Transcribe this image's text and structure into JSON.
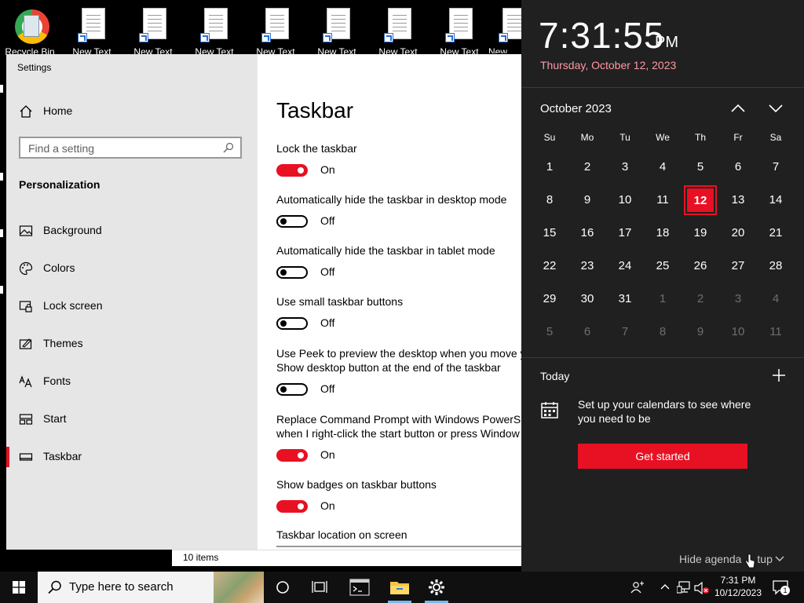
{
  "desktop": {
    "icons": [
      {
        "label": "Recycle Bin"
      },
      {
        "label": "New Text"
      },
      {
        "label": "New Text"
      },
      {
        "label": "New Text"
      },
      {
        "label": "New Text"
      },
      {
        "label": "New Text"
      },
      {
        "label": "New Text"
      },
      {
        "label": "New Text"
      },
      {
        "label": "New"
      }
    ]
  },
  "settings": {
    "window_title": "Settings",
    "home_label": "Home",
    "search_placeholder": "Find a setting",
    "section_title": "Personalization",
    "nav": [
      {
        "label": "Background",
        "icon": "picture-icon"
      },
      {
        "label": "Colors",
        "icon": "palette-icon"
      },
      {
        "label": "Lock screen",
        "icon": "lock-screen-icon"
      },
      {
        "label": "Themes",
        "icon": "themes-icon"
      },
      {
        "label": "Fonts",
        "icon": "fonts-icon"
      },
      {
        "label": "Start",
        "icon": "start-icon"
      },
      {
        "label": "Taskbar",
        "icon": "taskbar-icon",
        "active": true
      }
    ],
    "page_title": "Taskbar",
    "options": [
      {
        "label": "Lock the taskbar",
        "state": "On"
      },
      {
        "label": "Automatically hide the taskbar in desktop mode",
        "state": "Off"
      },
      {
        "label": "Automatically hide the taskbar in tablet mode",
        "state": "Off"
      },
      {
        "label": "Use small taskbar buttons",
        "state": "Off"
      },
      {
        "label_line1": "Use Peek to preview the desktop when you move y",
        "label_line2": "Show desktop button at the end of the taskbar",
        "state": "Off"
      },
      {
        "label_line1": "Replace Command Prompt with Windows PowerSh",
        "label_line2": "when I right-click the start button or press Window",
        "state": "On"
      },
      {
        "label": "Show badges on taskbar buttons",
        "state": "On"
      }
    ],
    "location_label": "Taskbar location on screen"
  },
  "explorer": {
    "status": "10 items"
  },
  "clock": {
    "time": "7:31:55",
    "ampm": "PM",
    "date": "Thursday, October 12, 2023",
    "month_label": "October 2023",
    "weekdays": [
      "Su",
      "Mo",
      "Tu",
      "We",
      "Th",
      "Fr",
      "Sa"
    ],
    "days": [
      [
        "1",
        "2",
        "3",
        "4",
        "5",
        "6",
        "7"
      ],
      [
        "8",
        "9",
        "10",
        "11",
        "12",
        "13",
        "14"
      ],
      [
        "15",
        "16",
        "17",
        "18",
        "19",
        "20",
        "21"
      ],
      [
        "22",
        "23",
        "24",
        "25",
        "26",
        "27",
        "28"
      ],
      [
        "29",
        "30",
        "31",
        "1",
        "2",
        "3",
        "4"
      ],
      [
        "5",
        "6",
        "7",
        "8",
        "9",
        "10",
        "11"
      ]
    ],
    "today_label": "Today",
    "agenda_message": "Set up your calendars to see where you need to be",
    "get_started": "Get started",
    "hide_agenda": "Hide agenda",
    "hide_agenda_rest": "tup"
  },
  "taskbar": {
    "search_placeholder": "Type here to search",
    "time": "7:31 PM",
    "date": "10/12/2023",
    "notification_count": "1"
  },
  "colors": {
    "accent": "#e81123",
    "flyout_bg": "#202020",
    "date_text": "#ff99a4"
  }
}
